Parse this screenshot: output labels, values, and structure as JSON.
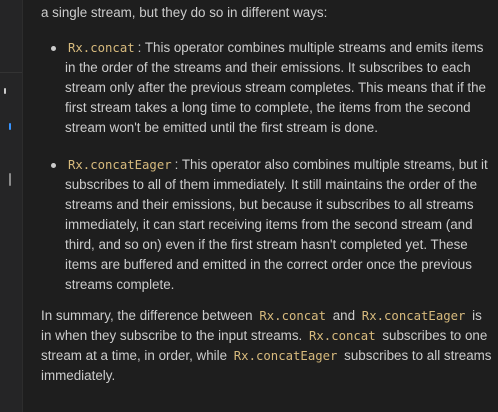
{
  "intro": {
    "text": "a single stream, but they do so in different ways:"
  },
  "bullets": [
    {
      "code": "Rx.concat",
      "text": ": This operator combines multiple streams and emits items in the order of the streams and their emissions. It subscribes to each stream only after the previous stream completes. This means that if the first stream takes a long time to complete, the items from the second stream won't be emitted until the first stream is done."
    },
    {
      "code": "Rx.concatEager",
      "text": ": This operator also combines multiple streams, but it subscribes to all of them immediately. It still maintains the order of the streams and their emissions, but because it subscribes to all streams immediately, it can start receiving items from the second stream (and third, and so on) even if the first stream hasn't completed yet. These items are buffered and emitted in the correct order once the previous streams complete."
    }
  ],
  "summary": {
    "part1": "In summary, the difference between ",
    "code1": "Rx.concat",
    "part2": " and ",
    "code2": "Rx.concatEager",
    "part3": " is in when they subscribe to the input streams. ",
    "code3": "Rx.concat",
    "part4": " subscribes to one stream at a time, in order, while ",
    "code4": "Rx.concatEager",
    "part5": " subscribes to all streams immediately."
  },
  "colors": {
    "background": "#1e1e1e",
    "text": "#cccccc",
    "inline_code": "#d7ba7d",
    "sidebar": "#252526",
    "sidebar_mark_active": "#3794ff",
    "sidebar_mark_idle": "#8a8a8a"
  }
}
